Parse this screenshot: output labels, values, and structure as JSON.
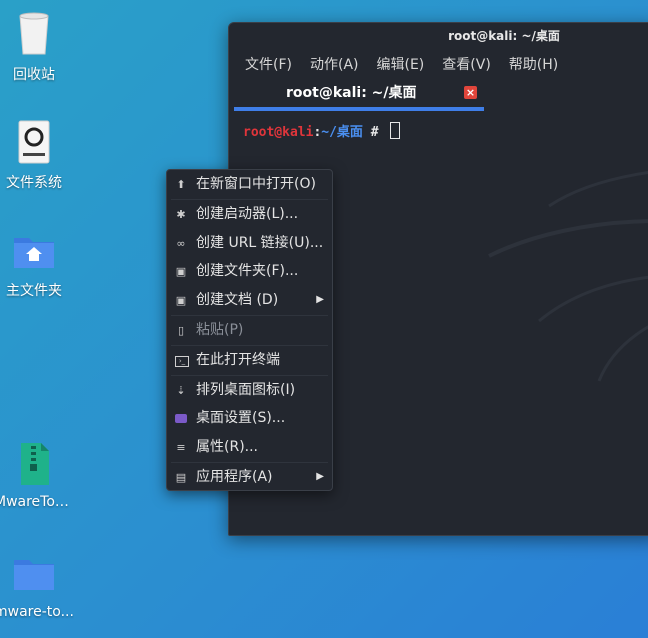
{
  "desktop": {
    "icons": [
      {
        "label": "回收站",
        "icon": "trash-icon"
      },
      {
        "label": "文件系统",
        "icon": "drive-icon"
      },
      {
        "label": "主文件夹",
        "icon": "home-folder-icon"
      },
      {
        "label": "MwareToo...",
        "icon": "archive-file-icon"
      },
      {
        "label": "mware-to...",
        "icon": "folder-icon"
      }
    ]
  },
  "terminal": {
    "title": "root@kali: ~/桌面",
    "menu": [
      "文件(F)",
      "动作(A)",
      "编辑(E)",
      "查看(V)",
      "帮助(H)"
    ],
    "tab_label": "root@kali: ~/桌面",
    "prompt_user": "root@kali",
    "prompt_sep": ":",
    "prompt_path": "~/桌面",
    "prompt_hash": "#"
  },
  "context_menu": {
    "items": [
      {
        "label": "在新窗口中打开(O)",
        "icon": "upload-icon",
        "disabled": false,
        "submenu": false
      },
      {
        "label": "创建启动器(L)...",
        "icon": "gear-icon",
        "disabled": false,
        "submenu": false
      },
      {
        "label": "创建 URL 链接(U)...",
        "icon": "link-icon",
        "disabled": false,
        "submenu": false
      },
      {
        "label": "创建文件夹(F)...",
        "icon": "new-folder-icon",
        "disabled": false,
        "submenu": false
      },
      {
        "label": "创建文档 (D)",
        "icon": "new-document-icon",
        "disabled": false,
        "submenu": true
      },
      {
        "label": "粘贴(P)",
        "icon": "paste-icon",
        "disabled": true,
        "submenu": false
      },
      {
        "label": "在此打开终端",
        "icon": "terminal-icon",
        "disabled": false,
        "submenu": false
      },
      {
        "label": "排列桌面图标(I)",
        "icon": "arrange-icon",
        "disabled": false,
        "submenu": false
      },
      {
        "label": "桌面设置(S)...",
        "icon": "desktop-settings-icon",
        "disabled": false,
        "submenu": false
      },
      {
        "label": "属性(R)...",
        "icon": "properties-icon",
        "disabled": false,
        "submenu": false
      },
      {
        "label": "应用程序(A)",
        "icon": "applications-icon",
        "disabled": false,
        "submenu": true
      }
    ]
  },
  "colors": {
    "accent": "#3f7ee8",
    "prompt_user": "#e0353b",
    "prompt_path": "#4a8ff0",
    "close_button": "#e0453b"
  }
}
